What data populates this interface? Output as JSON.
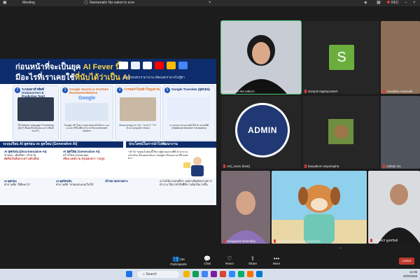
{
  "topbar": {
    "tab1": "Meeting",
    "tab2": "Nantamalin Na nakorn's scre",
    "rec": "REC"
  },
  "slide": {
    "title_line1": "ก่อนหน้าที่จะเป็นยุค ",
    "title_line1_accent": "AI Fever นี้",
    "title_line2": "มีอะไรที่เราเคยใช้",
    "title_line2_accent": "ที่นับได้ว่าเป็น AI",
    "subtitle": "AI อยู่รอบตัวเรามานาน เพียงแต่เราอาจไม่รู้ตัว",
    "cards": [
      {
        "num": "2",
        "title": "ระบบเดาคำศัพท์ (Autocorrect & Predictive Text)",
        "text": "ใช้ Natural Language Processing (NLP) ที่เคยเรียนรู้รูปแบบการพิมพ์ของเรา"
      },
      {
        "num": "3",
        "title": "Google Search & YouTube Recommendations",
        "google": "Google",
        "text": "Google เข้าใจความหมายของคำค้นหา และแนะนำวิดีโอที่ตรงใจ AI Recommender System"
      },
      {
        "num": "4",
        "title": "การจดจำใบหน้าในรูปภาพ",
        "text": "จัดหมวดหมู่ภาพ \"คน\" \"อาหาร\" \"วิว\" ด้วย Computer Vision"
      },
      {
        "num": "5",
        "title": "Google Translate (ยุคก่อน)",
        "text": "การแปลภาษาแบบเดิมใช้ AI แบบสถิติ (Statistical Machine Translation)"
      }
    ],
    "section_left": "ระบบเรียน AI ยุคก่อน vs ยุคใหม่ (Generative AI)",
    "section_right": "ประโยชน์ในการนำไปพัฒนางาน",
    "col_old_title": "AI ยุคก่อน (Discriminative AI)",
    "col_old_items": "จำแนก / คัดเลือก / ทำนาย",
    "col_old_ex": "ตัดสินใจเลือกระหว่างตัวเลือก",
    "col_new_title": "AI ยุคใหม่ (Generative AI)",
    "col_new_items": "สร้างใหม่ (Generate)",
    "col_new_ex": "เขียน บทความ สรุปเอกสาร วาดรูป",
    "tip": "\"เข้าใจ\" ทุกคนในห้องนี้ใช้งานผู้ช่วยฉลาดที่มี AI มานานแล้วจริงๆ ตั้งแต่ออกค้นหา Google หรือจองเวลาที่ไอเฟลทาว",
    "bottom_old": "AI ยุคก่อน",
    "bottom_old_text": "คำถามคือ \"นี่คืออะไร\"",
    "bottom_new": "AI ยุคปัจจุบัน",
    "bottom_new_text": "คำถามคือ \"ช่วยออกแบบเว็บให้\"",
    "bottom_goal": "เป้าหมายปลายทาง",
    "bottom_quote": "AI ไม่ได้มาแทนที่เรา แต่มาเพิ่มศักยภาพการทำงาน ให้เราทำสิ่งที่ดีกว่าเดิมได้มากขึ้น"
  },
  "participants": [
    {
      "name": "Nantamalin Na nakorn",
      "muted": false
    },
    {
      "name": "Sompis Ngamprasert",
      "muted": true
    },
    {
      "name": "Yuwadee Aramsak",
      "muted": true
    },
    {
      "name": "ADMIN",
      "muted": true
    },
    {
      "name": "Arit_zoom (host)",
      "muted": true
    },
    {
      "name": "kanyakorn ariyanapha",
      "muted": true
    },
    {
      "name": "Adisak SC",
      "muted": true
    },
    {
      "name": "Sangpanit Maleethip",
      "muted": true
    },
    {
      "name": "Kritphum Wangphas (scimutto)",
      "muted": true
    },
    {
      "name": "มีพงศธร พูลทรัพย์",
      "muted": true
    }
  ],
  "avatar_letter": "S",
  "admin_label": "ADMIN",
  "toolbar": {
    "participants_count": "236",
    "participants": "Participants",
    "chat": "Chat",
    "react": "React",
    "share": "Share",
    "more": "More",
    "leave": "Leave"
  },
  "taskbar": {
    "search": "Search",
    "time": "11:05",
    "date": "30/9/2568"
  }
}
